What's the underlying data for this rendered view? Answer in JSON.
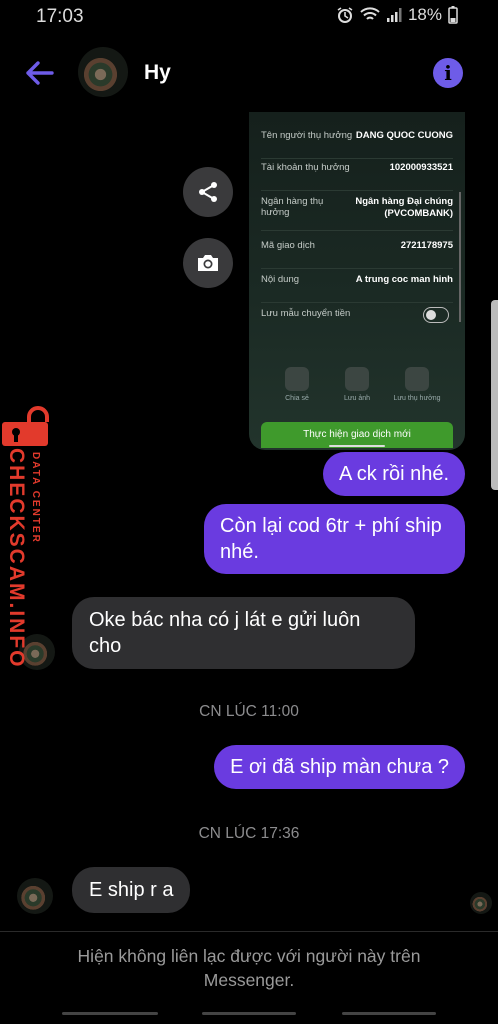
{
  "status": {
    "time": "17:03",
    "battery": "18%"
  },
  "header": {
    "contact_name": "Hy"
  },
  "shared_card": {
    "rows": [
      {
        "label": "Tên người thụ hưởng",
        "value": "DANG QUOC CUONG"
      },
      {
        "label": "Tài khoản thụ hưởng",
        "value": "102000933521"
      },
      {
        "label": "Ngân hàng thụ hưởng",
        "value": "Ngân hàng Đại chúng (PVCOMBANK)"
      },
      {
        "label": "Mã giao dịch",
        "value": "2721178975"
      },
      {
        "label": "Nội dung",
        "value": "A trung coc man hinh"
      }
    ],
    "save_template_label": "Lưu mẫu chuyển tiền",
    "actions": [
      "Chia sẻ",
      "Lưu ảnh",
      "Lưu thụ hưởng"
    ],
    "new_transaction": "Thực hiện giao dịch mới"
  },
  "messages": {
    "m1": "A ck rồi nhé.",
    "m2": "Còn lại cod 6tr + phí ship nhé.",
    "m3": "Oke bác nha có j lát e gửi luôn cho",
    "ts1": "CN LÚC 11:00",
    "m4": "E ơi đã ship màn chưa ?",
    "ts2": "CN LÚC 17:36",
    "m5": "E ship r a"
  },
  "watermark": {
    "main": "CHECKSCAM.INFO",
    "sub": "DATA CENTER"
  },
  "footer": {
    "notice": "Hiện không liên lạc được với người này trên Messenger."
  },
  "colors": {
    "accent": "#6e5ce8",
    "outgoing_bubble": "#6a3be0",
    "incoming_bubble": "#2f2f31",
    "watermark": "#e23a2c"
  }
}
